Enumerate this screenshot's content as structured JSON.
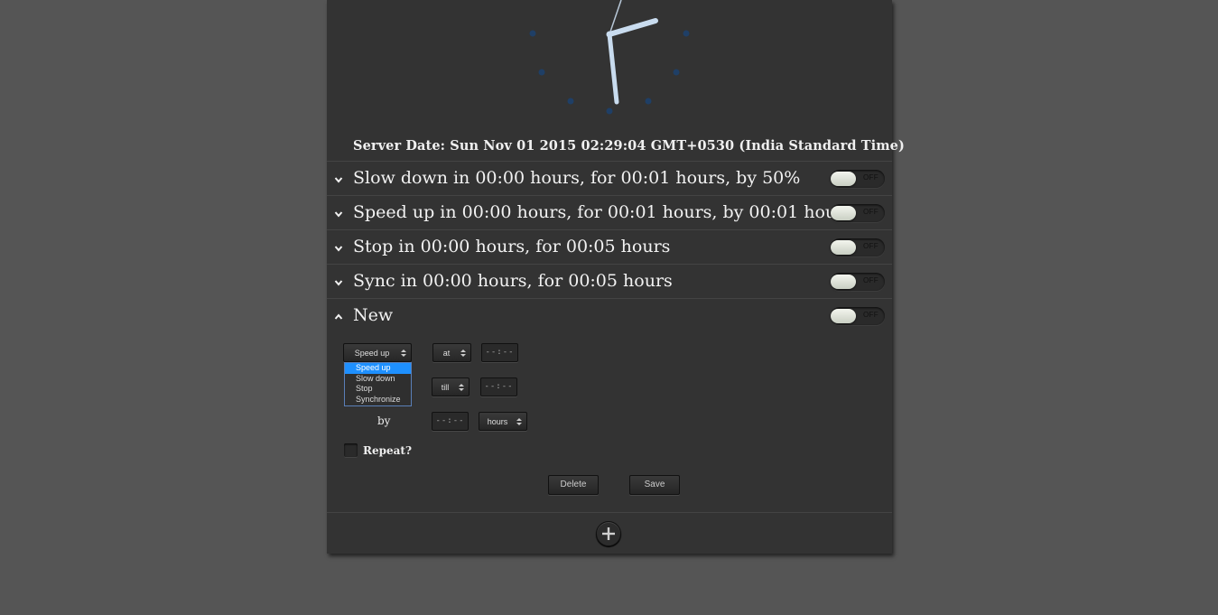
{
  "server_date": "Server Date: Sun Nov 01 2015 02:29:04 GMT+0530 (India Standard Time)",
  "alarms": [
    {
      "title": "Slow down in 00:00 hours, for 00:01 hours, by 50%",
      "expanded": false,
      "toggle": "OFF"
    },
    {
      "title": "Speed up in 00:00 hours, for 00:01 hours, by 00:01 hours",
      "expanded": false,
      "toggle": "OFF"
    },
    {
      "title": "Stop in 00:00 hours, for 00:05 hours",
      "expanded": false,
      "toggle": "OFF"
    },
    {
      "title": "Sync in 00:00 hours, for 00:05 hours",
      "expanded": false,
      "toggle": "OFF"
    },
    {
      "title": "New",
      "expanded": true,
      "toggle": "OFF"
    }
  ],
  "editor": {
    "action_select": "Speed up",
    "action_options": [
      "Speed up",
      "Slow down",
      "Stop",
      "Synchronize"
    ],
    "start_mode": "at",
    "start_time": "--:--",
    "end_mode": "till",
    "end_time": "--:--",
    "by_label": "by",
    "by_time": "--:--",
    "by_unit": "hours",
    "repeat_label": "Repeat?",
    "delete_label": "Delete",
    "save_label": "Save"
  },
  "colors": {
    "page_bg": "#555555",
    "panel_bg": "#333333",
    "clock_hands": "#c9dcef",
    "clock_markers": "#1f3f66",
    "dropdown_selected": "#1e90ff"
  },
  "icons": {
    "row_collapsed": "chevron-down-icon",
    "row_expanded": "chevron-up-icon",
    "spinner": "spinner-arrows-icon",
    "add": "plus-icon"
  }
}
